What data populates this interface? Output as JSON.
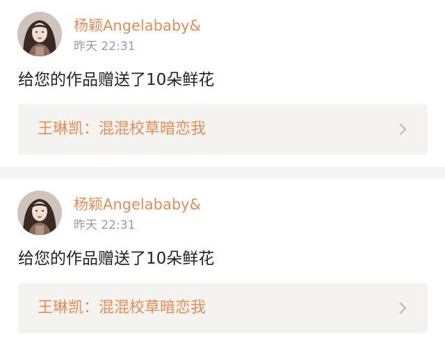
{
  "notifications": [
    {
      "user": {
        "name": "杨颖Angelababy&",
        "avatar_icon": "avatar-photo"
      },
      "time": "昨天 22:31",
      "message": "给您的作品赠送了10朵鲜花",
      "work": {
        "title": "王琳凯：混混校草暗恋我",
        "arrow_icon": "chevron-right-icon"
      }
    },
    {
      "user": {
        "name": "杨颖Angelababy&",
        "avatar_icon": "avatar-photo"
      },
      "time": "昨天 22:31",
      "message": "给您的作品赠送了10朵鲜花",
      "work": {
        "title": "王琳凯：混混校草暗恋我",
        "arrow_icon": "chevron-right-icon"
      }
    }
  ],
  "colors": {
    "accent": "#e88c55",
    "message_text": "#222222",
    "timestamp": "#9a9a9a",
    "link_background": "#f4f3ef",
    "separator": "#f4f4f4"
  }
}
